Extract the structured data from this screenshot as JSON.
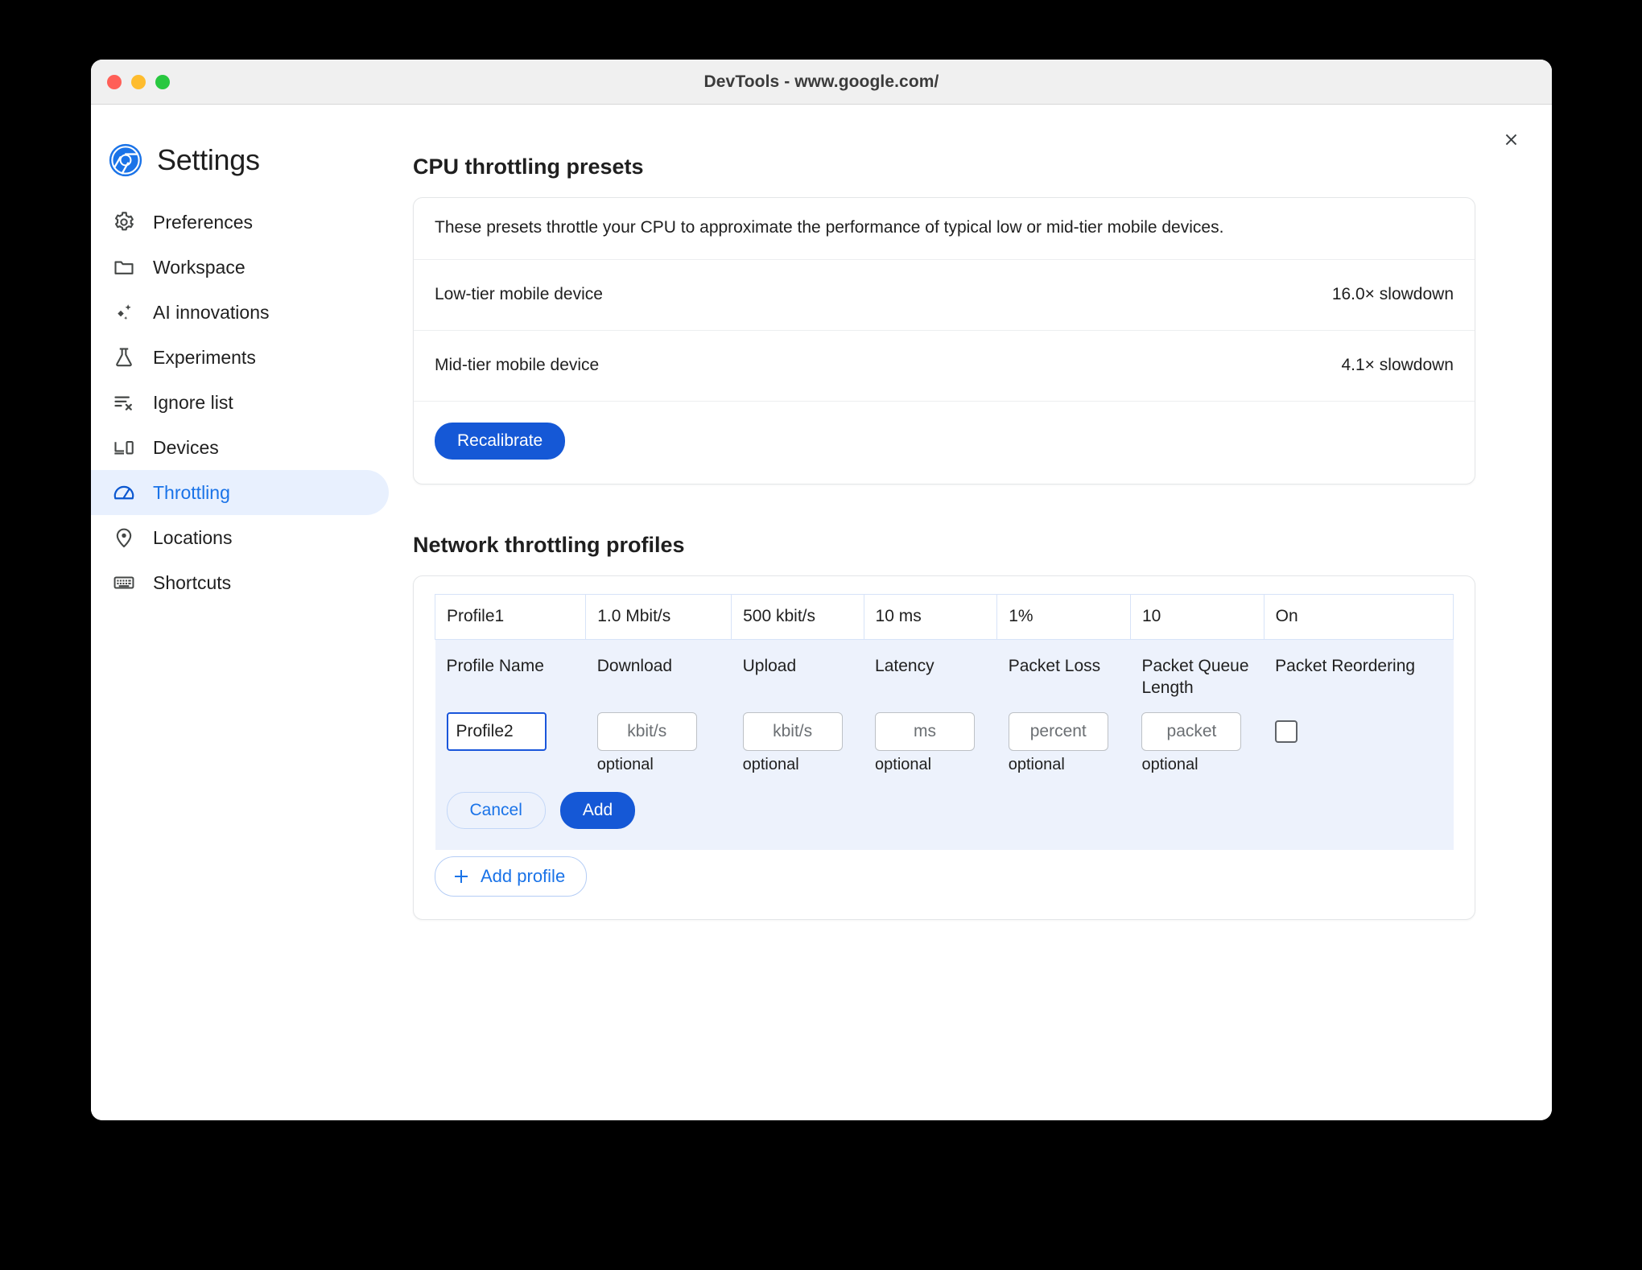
{
  "window": {
    "title": "DevTools - www.google.com/",
    "close_label": "×"
  },
  "settings": {
    "title": "Settings",
    "logo_icon": "chrome-logo-icon",
    "close_icon": "close-icon"
  },
  "sidebar": {
    "items": [
      {
        "label": "Preferences",
        "icon": "gear-icon",
        "selected": false
      },
      {
        "label": "Workspace",
        "icon": "folder-icon",
        "selected": false
      },
      {
        "label": "AI innovations",
        "icon": "sparkle-icon",
        "selected": false
      },
      {
        "label": "Experiments",
        "icon": "flask-icon",
        "selected": false
      },
      {
        "label": "Ignore list",
        "icon": "list-x-icon",
        "selected": false
      },
      {
        "label": "Devices",
        "icon": "devices-icon",
        "selected": false
      },
      {
        "label": "Throttling",
        "icon": "speedometer-icon",
        "selected": true
      },
      {
        "label": "Locations",
        "icon": "location-pin-icon",
        "selected": false
      },
      {
        "label": "Shortcuts",
        "icon": "keyboard-icon",
        "selected": false
      }
    ]
  },
  "cpu_presets": {
    "heading": "CPU throttling presets",
    "description": "These presets throttle your CPU to approximate the performance of typical low or mid-tier mobile devices.",
    "rows": [
      {
        "name": "Low-tier mobile device",
        "value": "16.0× slowdown"
      },
      {
        "name": "Mid-tier mobile device",
        "value": "4.1× slowdown"
      }
    ],
    "recalibrate_label": "Recalibrate"
  },
  "network_profiles": {
    "heading": "Network throttling profiles",
    "columns": [
      "Profile Name",
      "Download",
      "Upload",
      "Latency",
      "Packet Loss",
      "Packet Queue Length",
      "Packet Reordering"
    ],
    "existing_row": {
      "profile_name": "Profile1",
      "download": "1.0 Mbit/s",
      "upload": "500 kbit/s",
      "latency": "10 ms",
      "packet_loss": "1%",
      "packet_queue_length": "10",
      "packet_reordering": "On"
    },
    "new_row": {
      "profile_name_value": "Profile2",
      "download_placeholder": "kbit/s",
      "upload_placeholder": "kbit/s",
      "latency_placeholder": "ms",
      "packet_loss_placeholder": "percent",
      "packet_queue_length_placeholder": "packet",
      "packet_reordering_checked": false,
      "optional_label": "optional"
    },
    "cancel_label": "Cancel",
    "add_label": "Add",
    "add_profile_label": "Add profile",
    "add_profile_icon": "plus-icon"
  },
  "colors": {
    "accent_blue": "#1a73e8",
    "primary_button": "#1558d6",
    "selected_nav_bg": "#e8f0fe",
    "table_row_bg": "#edf2fc",
    "table_border": "#d7e3f8"
  }
}
